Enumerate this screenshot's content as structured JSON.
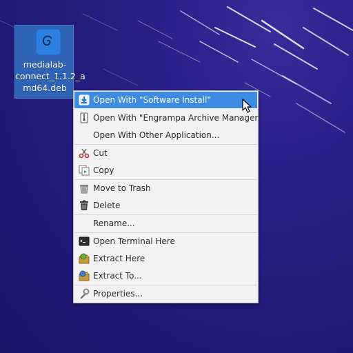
{
  "desktop": {
    "icon": {
      "name": "medialab-connect_1.1.2_amd64.deb",
      "label_lines": [
        "medialab-",
        "connect_1.1.2_a",
        "md64.deb"
      ]
    }
  },
  "context_menu": {
    "items": [
      {
        "label": "Open With \"Software Install\"",
        "icon": "software-install-icon"
      },
      {
        "label": "Open With \"Engrampa Archive Manager\"",
        "icon": "archive-manager-icon"
      },
      {
        "label": "Open With Other Application...",
        "icon": ""
      },
      {
        "label": "Cut",
        "icon": "scissors-icon"
      },
      {
        "label": "Copy",
        "icon": "copy-icon"
      },
      {
        "label": "Move to Trash",
        "icon": "trash-icon"
      },
      {
        "label": "Delete",
        "icon": "delete-icon"
      },
      {
        "label": "Rename...",
        "icon": ""
      },
      {
        "label": "Open Terminal Here",
        "icon": "terminal-icon"
      },
      {
        "label": "Extract Here",
        "icon": "extract-here-icon"
      },
      {
        "label": "Extract To...",
        "icon": "extract-to-icon"
      },
      {
        "label": "Properties...",
        "icon": "properties-icon"
      }
    ],
    "highlighted_item": "Open With \"Software Install\""
  },
  "colors": {
    "desktop_bg": "#241b7c",
    "highlight": "#3d8ce2",
    "icon_selection": "#2f63b5"
  }
}
